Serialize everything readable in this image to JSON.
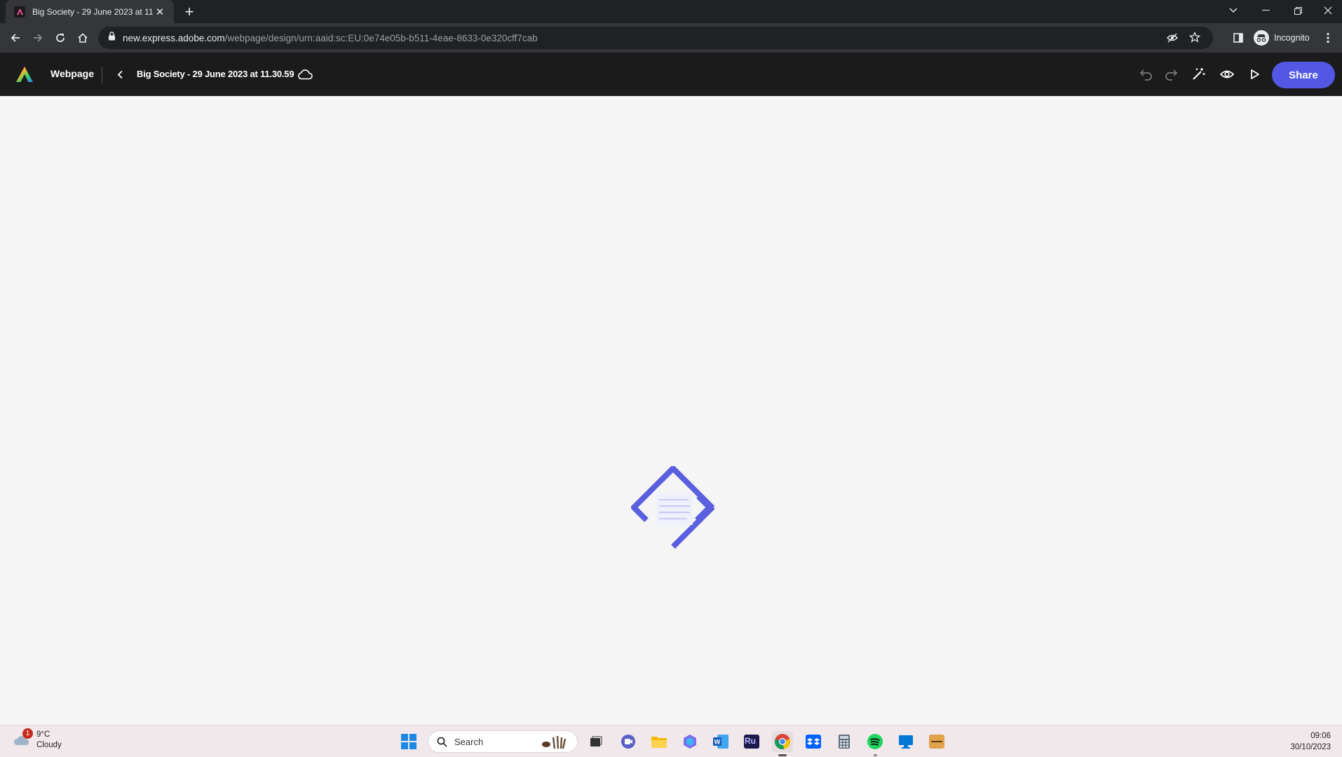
{
  "browser": {
    "tab_title": "Big Society - 29 June 2023 at 11",
    "url_host": "new.express.adobe.com",
    "url_path": "/webpage/design/urn:aaid:sc:EU:0e74e05b-b511-4eae-8633-0e320cff7cab",
    "profile_label": "Incognito"
  },
  "app": {
    "product_label": "Webpage",
    "document_title": "Big Society - 29 June 2023 at 11.30.59",
    "share_label": "Share",
    "accent_color": "#5258e4"
  },
  "canvas": {
    "state": "loading",
    "loader_color": "#5a5fe0"
  },
  "taskbar": {
    "weather_temp": "9°C",
    "weather_desc": "Cloudy",
    "weather_badge": "1",
    "search_placeholder": "Search",
    "ru_label": "Ru",
    "time": "09:06",
    "date": "30/10/2023",
    "apps": [
      "start-icon",
      "search",
      "task-view-icon",
      "teams-icon",
      "file-explorer-icon",
      "copilot-icon",
      "word-icon",
      "ru-app-icon",
      "chrome-icon",
      "dropbox-icon",
      "calculator-icon",
      "spotify-icon",
      "remote-desktop-icon",
      "sonos-icon"
    ]
  }
}
